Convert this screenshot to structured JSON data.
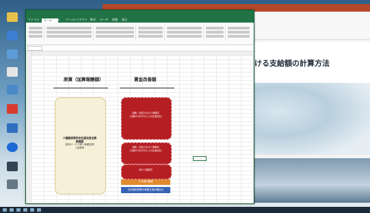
{
  "excel": {
    "tabs": [
      "ファイル",
      "ホーム",
      "挿入",
      "ページレイアウト",
      "数式",
      "データ",
      "校閲",
      "表示"
    ],
    "header_left": "原資（加算報酬額）",
    "header_right": "賃金改善額",
    "beige_text_title": "介護職員等特定処遇改善加算",
    "beige_text_sub": "報酬額",
    "beige_text_lines": [
      "（基本サービス費＋各種加算）",
      "×加算率"
    ],
    "red_box_1": [
      "経験・技能のある介護職員",
      "（月額平均8万円以上の処遇改善）"
    ],
    "red_box_2": [
      "経験・技能のある介護職員",
      "（月額平均8万円以上の処遇改善）"
    ],
    "red_box_3": [
      "他の介護職員"
    ],
    "orange_label": "その他の職種",
    "blue_label": "法定福利費等の事業主負担増加分"
  },
  "ppt": {
    "slide_title": "ける支給額の計算方法"
  },
  "colors": {
    "excel_green": "#217346",
    "ppt_red": "#b7472a",
    "red_box": "#b51f24",
    "orange": "#e28a2f",
    "blue": "#3963b5",
    "beige": "#f6f0d9"
  }
}
